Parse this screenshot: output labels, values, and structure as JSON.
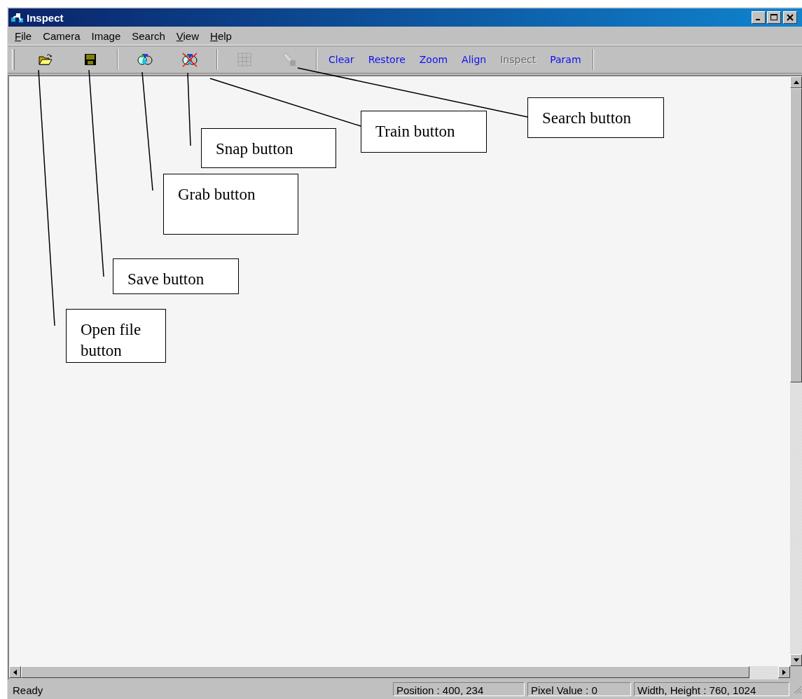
{
  "window": {
    "title": "Inspect"
  },
  "menu": [
    {
      "label": "File",
      "mnemonic": true
    },
    {
      "label": "Camera",
      "mnemonic": false
    },
    {
      "label": "Image",
      "mnemonic": false
    },
    {
      "label": "Search",
      "mnemonic": false
    },
    {
      "label": "View",
      "mnemonic": true
    },
    {
      "label": "Help",
      "mnemonic": true
    }
  ],
  "toolbar": {
    "icon_groups": [
      {
        "buttons": [
          {
            "disabled": false
          },
          {
            "disabled": false
          }
        ]
      },
      {
        "buttons": [
          {
            "disabled": false
          },
          {
            "disabled": false
          }
        ]
      },
      {
        "buttons": [
          {
            "disabled": true
          },
          {
            "disabled": true
          }
        ]
      }
    ],
    "text_buttons": [
      {
        "label": "Clear",
        "disabled": false
      },
      {
        "label": "Restore",
        "disabled": false
      },
      {
        "label": "Zoom",
        "disabled": false
      },
      {
        "label": "Align",
        "disabled": false
      },
      {
        "label": "Inspect",
        "disabled": true
      },
      {
        "label": "Param",
        "disabled": false
      }
    ]
  },
  "status_bar": [
    "Ready",
    "Position : 400, 234",
    "Pixel Value : 0",
    "Width, Height : 760, 1024"
  ],
  "annotations": [
    {
      "text": "Search button"
    },
    {
      "text": "Train button"
    },
    {
      "text": "Snap button"
    },
    {
      "text": "Grab button"
    },
    {
      "text": "Save button"
    },
    {
      "text": "Open file button"
    }
  ]
}
